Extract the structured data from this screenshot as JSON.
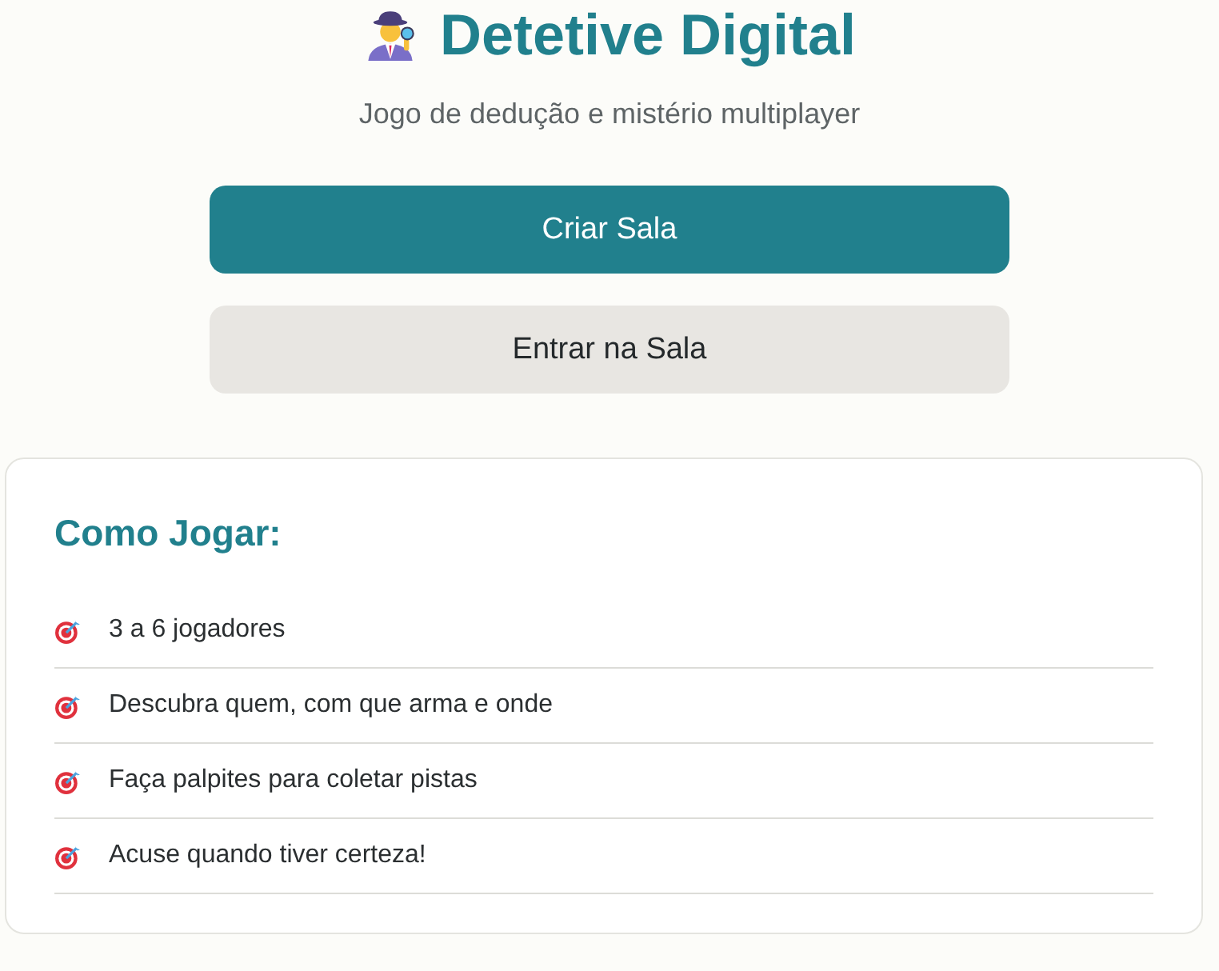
{
  "header": {
    "title": "Detetive Digital",
    "subtitle": "Jogo de dedução e mistério multiplayer"
  },
  "buttons": [
    {
      "label": "Criar Sala",
      "kind": "primary"
    },
    {
      "label": "Entrar na Sala",
      "kind": "secondary"
    }
  ],
  "instructions": {
    "title": "Como Jogar:",
    "items": [
      "3 a 6 jogadores",
      "Descubra quem, com que arma e onde",
      "Faça palpites para coletar pistas",
      "Acuse quando tiver certeza!"
    ]
  }
}
